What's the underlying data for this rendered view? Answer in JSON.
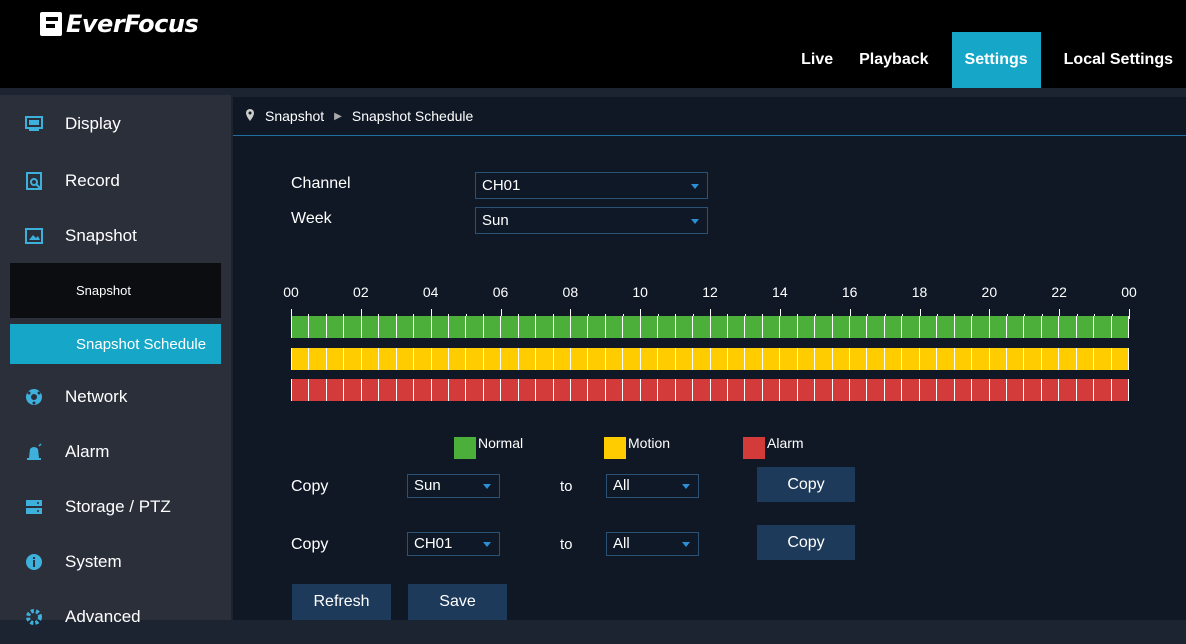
{
  "app": {
    "logo": "EverFocus"
  },
  "nav": {
    "items": [
      "Live",
      "Playback",
      "Settings",
      "Local Settings"
    ],
    "active": "Settings"
  },
  "sidebar": {
    "items": [
      {
        "label": "Display",
        "icon": "monitor-icon"
      },
      {
        "label": "Record",
        "icon": "record-search-icon"
      },
      {
        "label": "Snapshot",
        "icon": "image-icon"
      }
    ],
    "sub": {
      "snapshot": "Snapshot",
      "schedule": "Snapshot Schedule"
    },
    "items2": [
      {
        "label": "Network",
        "icon": "network-globe-icon"
      },
      {
        "label": "Alarm",
        "icon": "alarm-bell-icon"
      },
      {
        "label": "Storage / PTZ",
        "icon": "storage-icon"
      },
      {
        "label": "System",
        "icon": "info-icon"
      },
      {
        "label": "Advanced",
        "icon": "gear-icon"
      }
    ]
  },
  "breadcrumb": {
    "root": "Snapshot",
    "current": "Snapshot Schedule"
  },
  "form": {
    "channel_label": "Channel",
    "channel_value": "CH01",
    "week_label": "Week",
    "week_value": "Sun"
  },
  "schedule": {
    "hour_labels": [
      "00",
      "02",
      "04",
      "06",
      "08",
      "10",
      "12",
      "14",
      "16",
      "18",
      "20",
      "22",
      "00"
    ],
    "cells_per_row": 48,
    "rows": [
      {
        "type": "Normal",
        "color": "#4caf3a"
      },
      {
        "type": "Motion",
        "color": "#ffcc00"
      },
      {
        "type": "Alarm",
        "color": "#d33a3a"
      }
    ]
  },
  "legend": [
    {
      "label": "Normal",
      "color": "#4caf3a"
    },
    {
      "label": "Motion",
      "color": "#ffcc00"
    },
    {
      "label": "Alarm",
      "color": "#d33a3a"
    }
  ],
  "copy1": {
    "label": "Copy",
    "from": "Sun",
    "to_label": "to",
    "to": "All",
    "button": "Copy"
  },
  "copy2": {
    "label": "Copy",
    "from": "CH01",
    "to_label": "to",
    "to": "All",
    "button": "Copy"
  },
  "actions": {
    "refresh": "Refresh",
    "save": "Save"
  }
}
